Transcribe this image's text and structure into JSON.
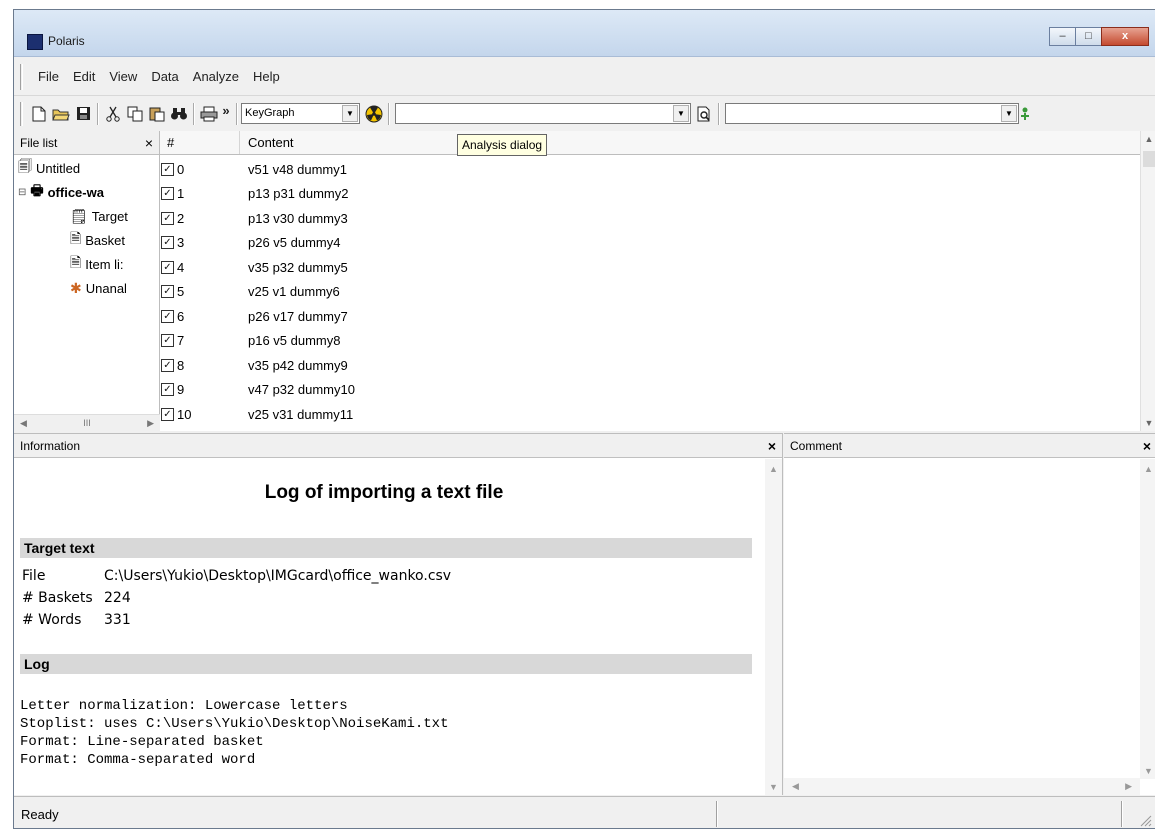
{
  "window": {
    "title": "Polaris",
    "min": "–",
    "max": "□",
    "close": "x"
  },
  "menu": [
    "File",
    "Edit",
    "View",
    "Data",
    "Analyze",
    "Help"
  ],
  "toolbar": {
    "more": "»",
    "mode_value": "KeyGraph",
    "search_value": "",
    "filter_value": "",
    "tooltip": "Analysis dialog"
  },
  "filelist": {
    "title": "File list",
    "close": "×",
    "items": [
      "Untitled",
      "office-wa",
      "Target",
      "Basket",
      "Item li:",
      "Unanal"
    ]
  },
  "grid": {
    "col_num": "#",
    "col_content": "Content",
    "rows": [
      {
        "n": "0",
        "c": "v51 v48 dummy1"
      },
      {
        "n": "1",
        "c": "p13 p31 dummy2"
      },
      {
        "n": "2",
        "c": "p13 v30 dummy3"
      },
      {
        "n": "3",
        "c": "p26 v5 dummy4"
      },
      {
        "n": "4",
        "c": "v35 p32 dummy5"
      },
      {
        "n": "5",
        "c": "v25 v1 dummy6"
      },
      {
        "n": "6",
        "c": "p26 v17 dummy7"
      },
      {
        "n": "7",
        "c": "p16 v5 dummy8"
      },
      {
        "n": "8",
        "c": "v35 p42 dummy9"
      },
      {
        "n": "9",
        "c": "v47 p32 dummy10"
      },
      {
        "n": "10",
        "c": "v25 v31 dummy11"
      }
    ]
  },
  "info": {
    "title": "Information",
    "close": "×",
    "heading": "Log of importing a text file",
    "section_target": "Target text",
    "file_label": "File",
    "file_value": "C:\\Users\\Yukio\\Desktop\\IMGcard\\office_wanko.csv",
    "baskets_label": "# Baskets",
    "baskets_value": "224",
    "words_label": "# Words",
    "words_value": "331",
    "section_log": "Log",
    "log_lines": [
      "Letter normalization: Lowercase letters",
      "Stoplist: uses C:\\Users\\Yukio\\Desktop\\NoiseKami.txt",
      "Format: Line-separated basket",
      "Format: Comma-separated word"
    ]
  },
  "comment": {
    "title": "Comment",
    "close": "×"
  },
  "status": {
    "text": "Ready"
  }
}
